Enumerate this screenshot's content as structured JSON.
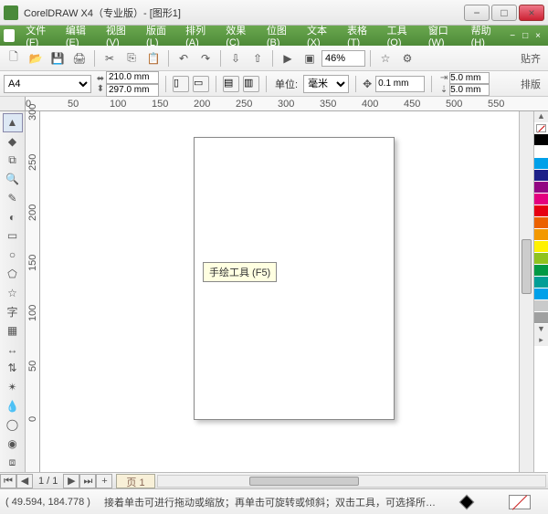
{
  "title": "CorelDRAW X4（专业版）- [图形1]",
  "menu": {
    "items": [
      "文件(F)",
      "编辑(E)",
      "视图(V)",
      "版面(L)",
      "排列(A)",
      "效果(C)",
      "位图(B)",
      "文本(X)",
      "表格(T)",
      "工具(O)",
      "窗口(W)",
      "帮助(H)"
    ]
  },
  "tb1": {
    "zoom": "46%",
    "endlabel": "贴齐"
  },
  "tb2": {
    "paper": "A4",
    "width": "210.0 mm",
    "height": "297.0 mm",
    "unit_label": "单位:",
    "unit_value": "毫米",
    "nudge": "0.1 mm",
    "dupx": "5.0 mm",
    "dupy": "5.0 mm",
    "endlabel": "排版"
  },
  "ruler_h": [
    "0",
    "50",
    "100",
    "150",
    "200",
    "250",
    "300",
    "350",
    "400",
    "450",
    "500",
    "550"
  ],
  "ruler_v": [
    "300",
    "250",
    "200",
    "150",
    "100",
    "50",
    "0"
  ],
  "tooltip": "手绘工具 (F5)",
  "palette": [
    "#000000",
    "#ffffff",
    "#00a0e9",
    "#1d2088",
    "#920783",
    "#e4007f",
    "#e60012",
    "#eb6100",
    "#f39800",
    "#fff100",
    "#8fc31f",
    "#009944",
    "#009e96",
    "#00a0e9",
    "#c9caca",
    "#9fa0a0"
  ],
  "pagenav": {
    "counter": "1 / 1",
    "tab": "页 1"
  },
  "status": {
    "coords": "( 49.594, 184.778 )",
    "hint": "接着单击可进行拖动或缩放；再单击可旋转或倾斜；双击工具，可选择所有对象；按住 S..."
  },
  "icons": {
    "new": "🗋",
    "open": "📂",
    "save": "💾",
    "print": "🖨",
    "cut": "✂",
    "copy": "⎘",
    "paste": "📋",
    "undo": "↶",
    "redo": "↷",
    "import": "⇩",
    "export": "⇧",
    "options": "⚙",
    "launch": "▶",
    "pick": "▲",
    "shape": "◆",
    "crop": "⧉",
    "zoom": "🔍",
    "freehand": "✎",
    "smartfill": "◐",
    "rect": "▭",
    "ellipse": "○",
    "polygon": "⬠",
    "basic": "☆",
    "text": "字",
    "table": "▦",
    "dimension": "↔",
    "connector": "⇅",
    "effects": "✴",
    "eyedrop": "💧",
    "outline": "◯",
    "fill": "◉",
    "ifill": "⧈",
    "first": "⏮",
    "prev": "◀",
    "next": "▶",
    "last": "⏭",
    "add": "+",
    "page": "▣",
    "min": "−",
    "max": "□",
    "close": "×"
  }
}
